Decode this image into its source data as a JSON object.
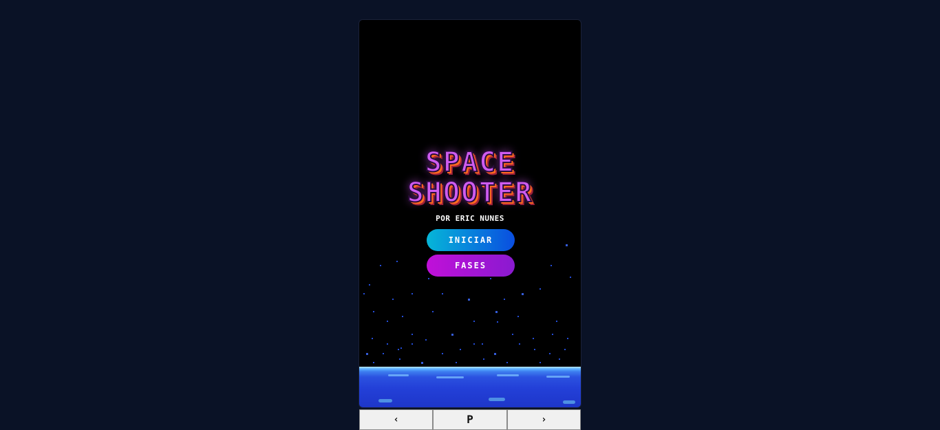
{
  "game": {
    "title_line1": "SPACE",
    "title_line2": "SHOOTER",
    "byline": "POR ERIC NUNES"
  },
  "menu": {
    "start_label": "INICIAR",
    "levels_label": "FASES"
  },
  "controls": {
    "left_label": "‹",
    "pause_label": "P",
    "right_label": "›"
  },
  "colors": {
    "page_background": "#0a1226",
    "title": "#cf5cf0",
    "title_shadow": "#ff6a1f",
    "start_button": "#06b6d8",
    "levels_button": "#c010d8",
    "stars": "#2a5bff",
    "planet": "#2340d8"
  }
}
